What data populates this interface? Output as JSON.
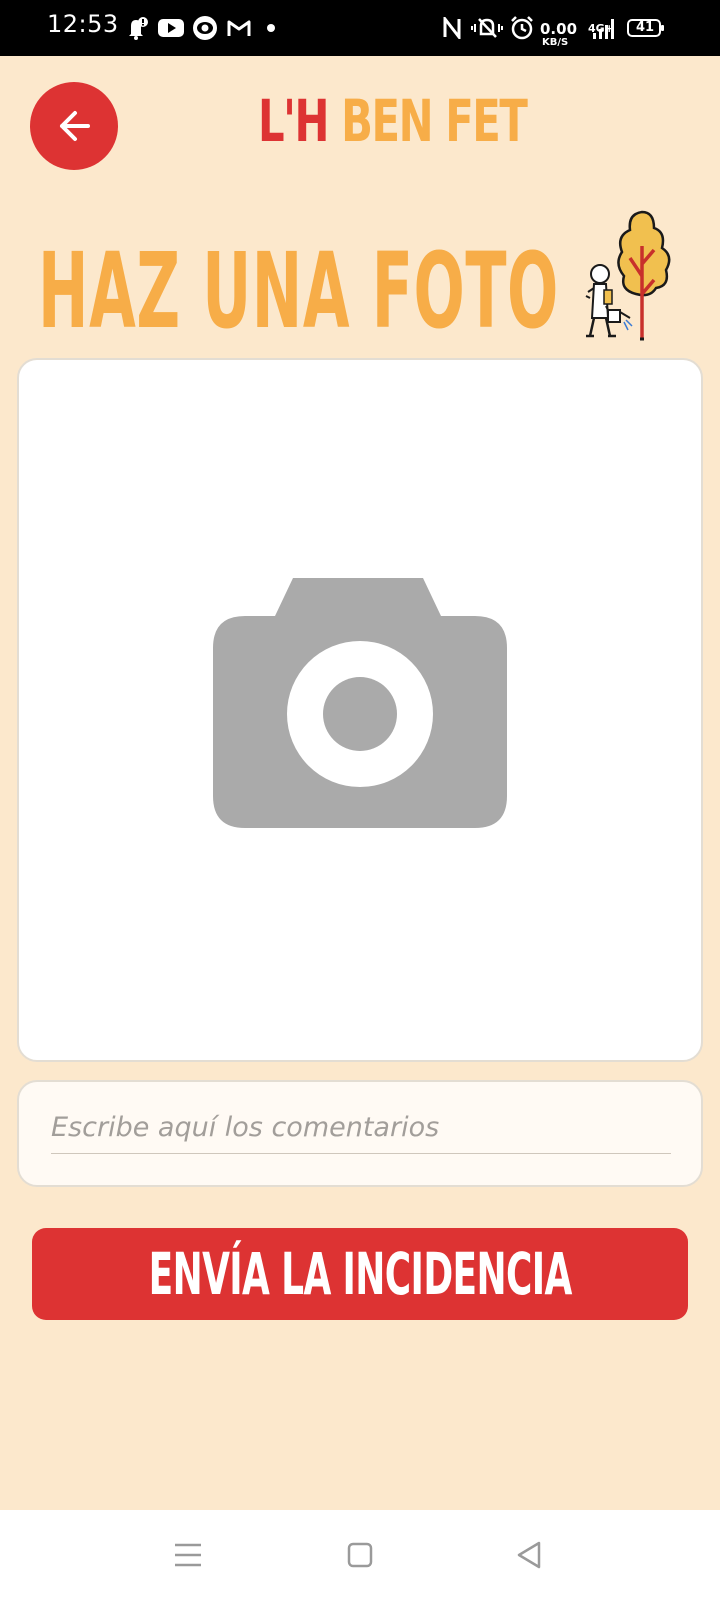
{
  "status_bar": {
    "time": "12:53",
    "network_speed": "0.00",
    "network_unit": "KB/S",
    "network_type": "4G+",
    "battery": "41",
    "icons": [
      "notification-alert-icon",
      "youtube-icon",
      "browser-icon",
      "gmail-icon",
      "dot-icon",
      "nfc-icon",
      "vibrate-icon",
      "alarm-icon",
      "signal-icon",
      "battery-icon"
    ]
  },
  "header": {
    "back_icon": "arrow-left-icon",
    "logo_part1": "L'H",
    "logo_part2": "BEN FET"
  },
  "page": {
    "title": "HAZ UNA FOTO"
  },
  "photo": {
    "icon": "camera-icon"
  },
  "comment": {
    "placeholder": "Escribe aquí los comentarios",
    "value": ""
  },
  "submit": {
    "label": "ENVÍA LA INCIDENCIA"
  },
  "nav": {
    "icons": [
      "menu-icon",
      "home-icon",
      "back-icon"
    ]
  },
  "colors": {
    "background": "#fce8cc",
    "accent_red": "#dd3333",
    "accent_orange": "#f7ad48",
    "camera_gray": "#aaaaaa"
  }
}
